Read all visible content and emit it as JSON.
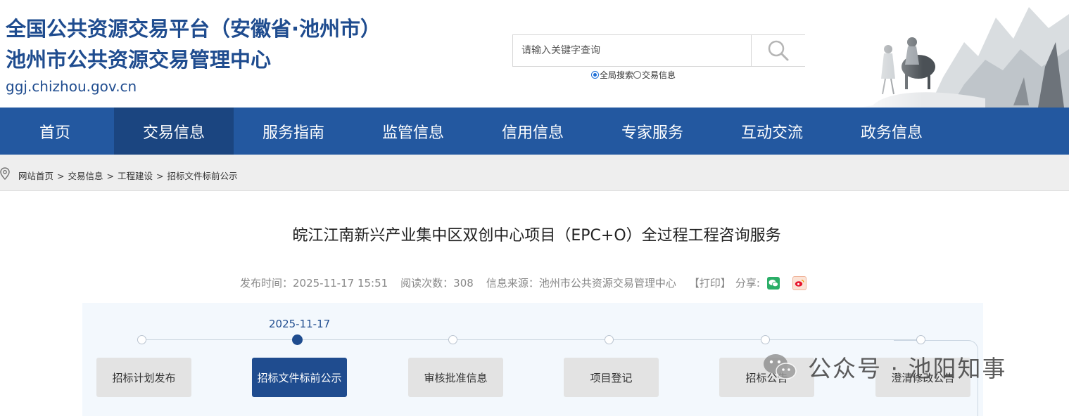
{
  "header": {
    "title_line1": "全国公共资源交易平台（安徽省·池州市）",
    "title_line2": "池州市公共资源交易管理中心",
    "domain": "ggj.chizhou.gov.cn"
  },
  "search": {
    "placeholder": "请输入关键字查询",
    "value": "",
    "scope_options": [
      "全局搜索",
      "交易信息"
    ],
    "scope_selected": "全局搜索"
  },
  "nav": {
    "items": [
      "首页",
      "交易信息",
      "服务指南",
      "监管信息",
      "信用信息",
      "专家服务",
      "互动交流",
      "政务信息"
    ],
    "active": "交易信息"
  },
  "breadcrumb": {
    "items": [
      "网站首页",
      "交易信息",
      "工程建设",
      "招标文件标前公示"
    ],
    "separator": ">"
  },
  "article": {
    "title": "皖江江南新兴产业集中区双创中心项目（EPC+O）全过程工程咨询服务",
    "publish_time": "发布时间：2025-11-17 15:51",
    "read_count": "阅读次数：308",
    "source": "信息来源：池州市公共资源交易管理中心",
    "print_label": "【打印】",
    "share_label": "分享:"
  },
  "progress": {
    "active_date": "2025-11-17",
    "steps": [
      "招标计划发布",
      "招标文件标前公示",
      "审核批准信息",
      "项目登记",
      "招标公告",
      "澄清修改公告"
    ],
    "active_index": 1
  },
  "watermark": {
    "text": "公众号 · 池阳知事"
  },
  "colors": {
    "brand_blue": "#1f4c8f",
    "nav_bg": "#2358a0",
    "nav_active": "#1b4580",
    "wechat_green": "#2aae67",
    "weibo_red": "#e6162d"
  },
  "icons": {
    "search": "magnifier-icon",
    "breadcrumb": "location-pin-icon",
    "share_wechat": "wechat-icon",
    "share_weibo": "weibo-icon"
  }
}
